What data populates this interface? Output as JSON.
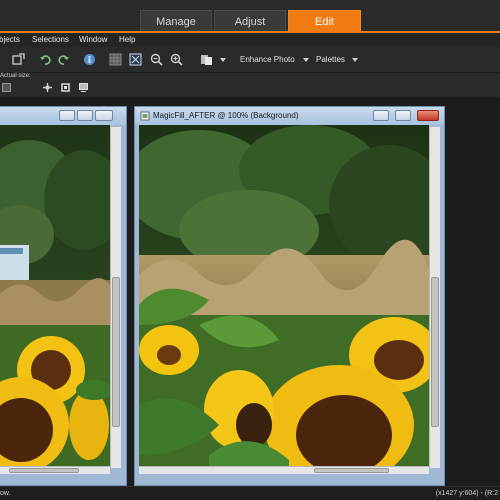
{
  "mode_tabs": [
    {
      "label": "Manage",
      "active": false
    },
    {
      "label": "Adjust",
      "active": false
    },
    {
      "label": "Edit",
      "active": true
    }
  ],
  "accent_color": "#f07c12",
  "menu": {
    "items": [
      "bjects",
      "Selections",
      "Window",
      "Help"
    ]
  },
  "toolbar": {
    "enhance_label": "Enhance Photo",
    "palettes_label": "Palettes",
    "icons": [
      "select-icon",
      "undo-icon",
      "redo-icon",
      "info-icon",
      "grid-icon",
      "fit-icon",
      "zoom-out-icon",
      "zoom-in-icon",
      "layers-icon"
    ]
  },
  "toolbar2": {
    "actual_size_label": "Actual size:",
    "icons": [
      "move-icon",
      "crop-icon",
      "resize-icon",
      "image-icon"
    ]
  },
  "windows": {
    "before": {
      "title": ""
    },
    "after": {
      "title": "MagicFill_AFTER @ 100% (Background)"
    }
  },
  "status": {
    "left": "ow.",
    "right": "(x1427 y:604) - (R:2"
  }
}
